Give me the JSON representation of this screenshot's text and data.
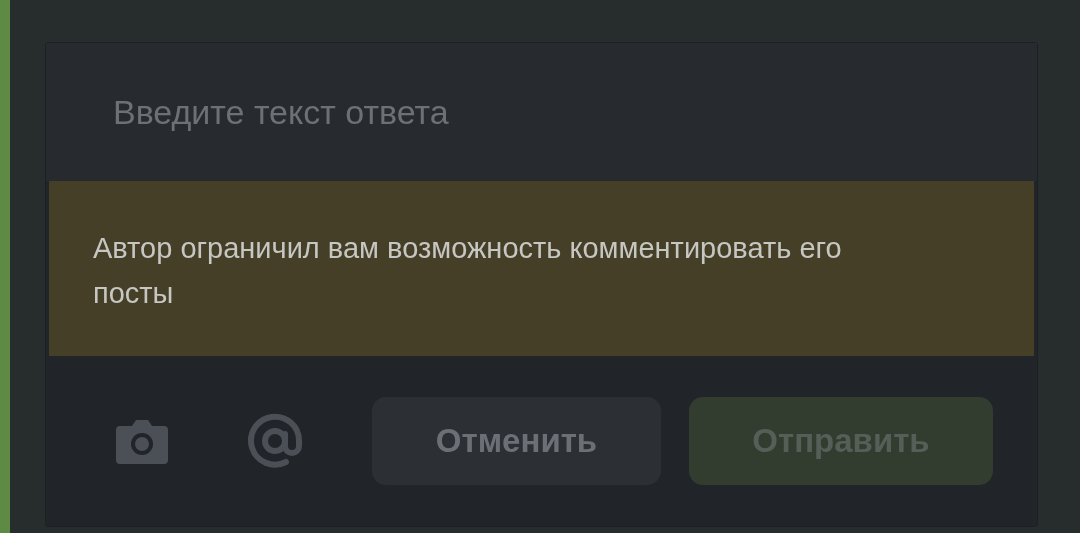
{
  "reply_form": {
    "placeholder": "Введите текст ответа",
    "notice": "Автор ограничил вам возможность комментировать его посты",
    "buttons": [
      {
        "label": "Отменить",
        "kind": "cancel",
        "disabled": false
      },
      {
        "label": "Отправить",
        "kind": "submit",
        "disabled": true
      }
    ]
  }
}
